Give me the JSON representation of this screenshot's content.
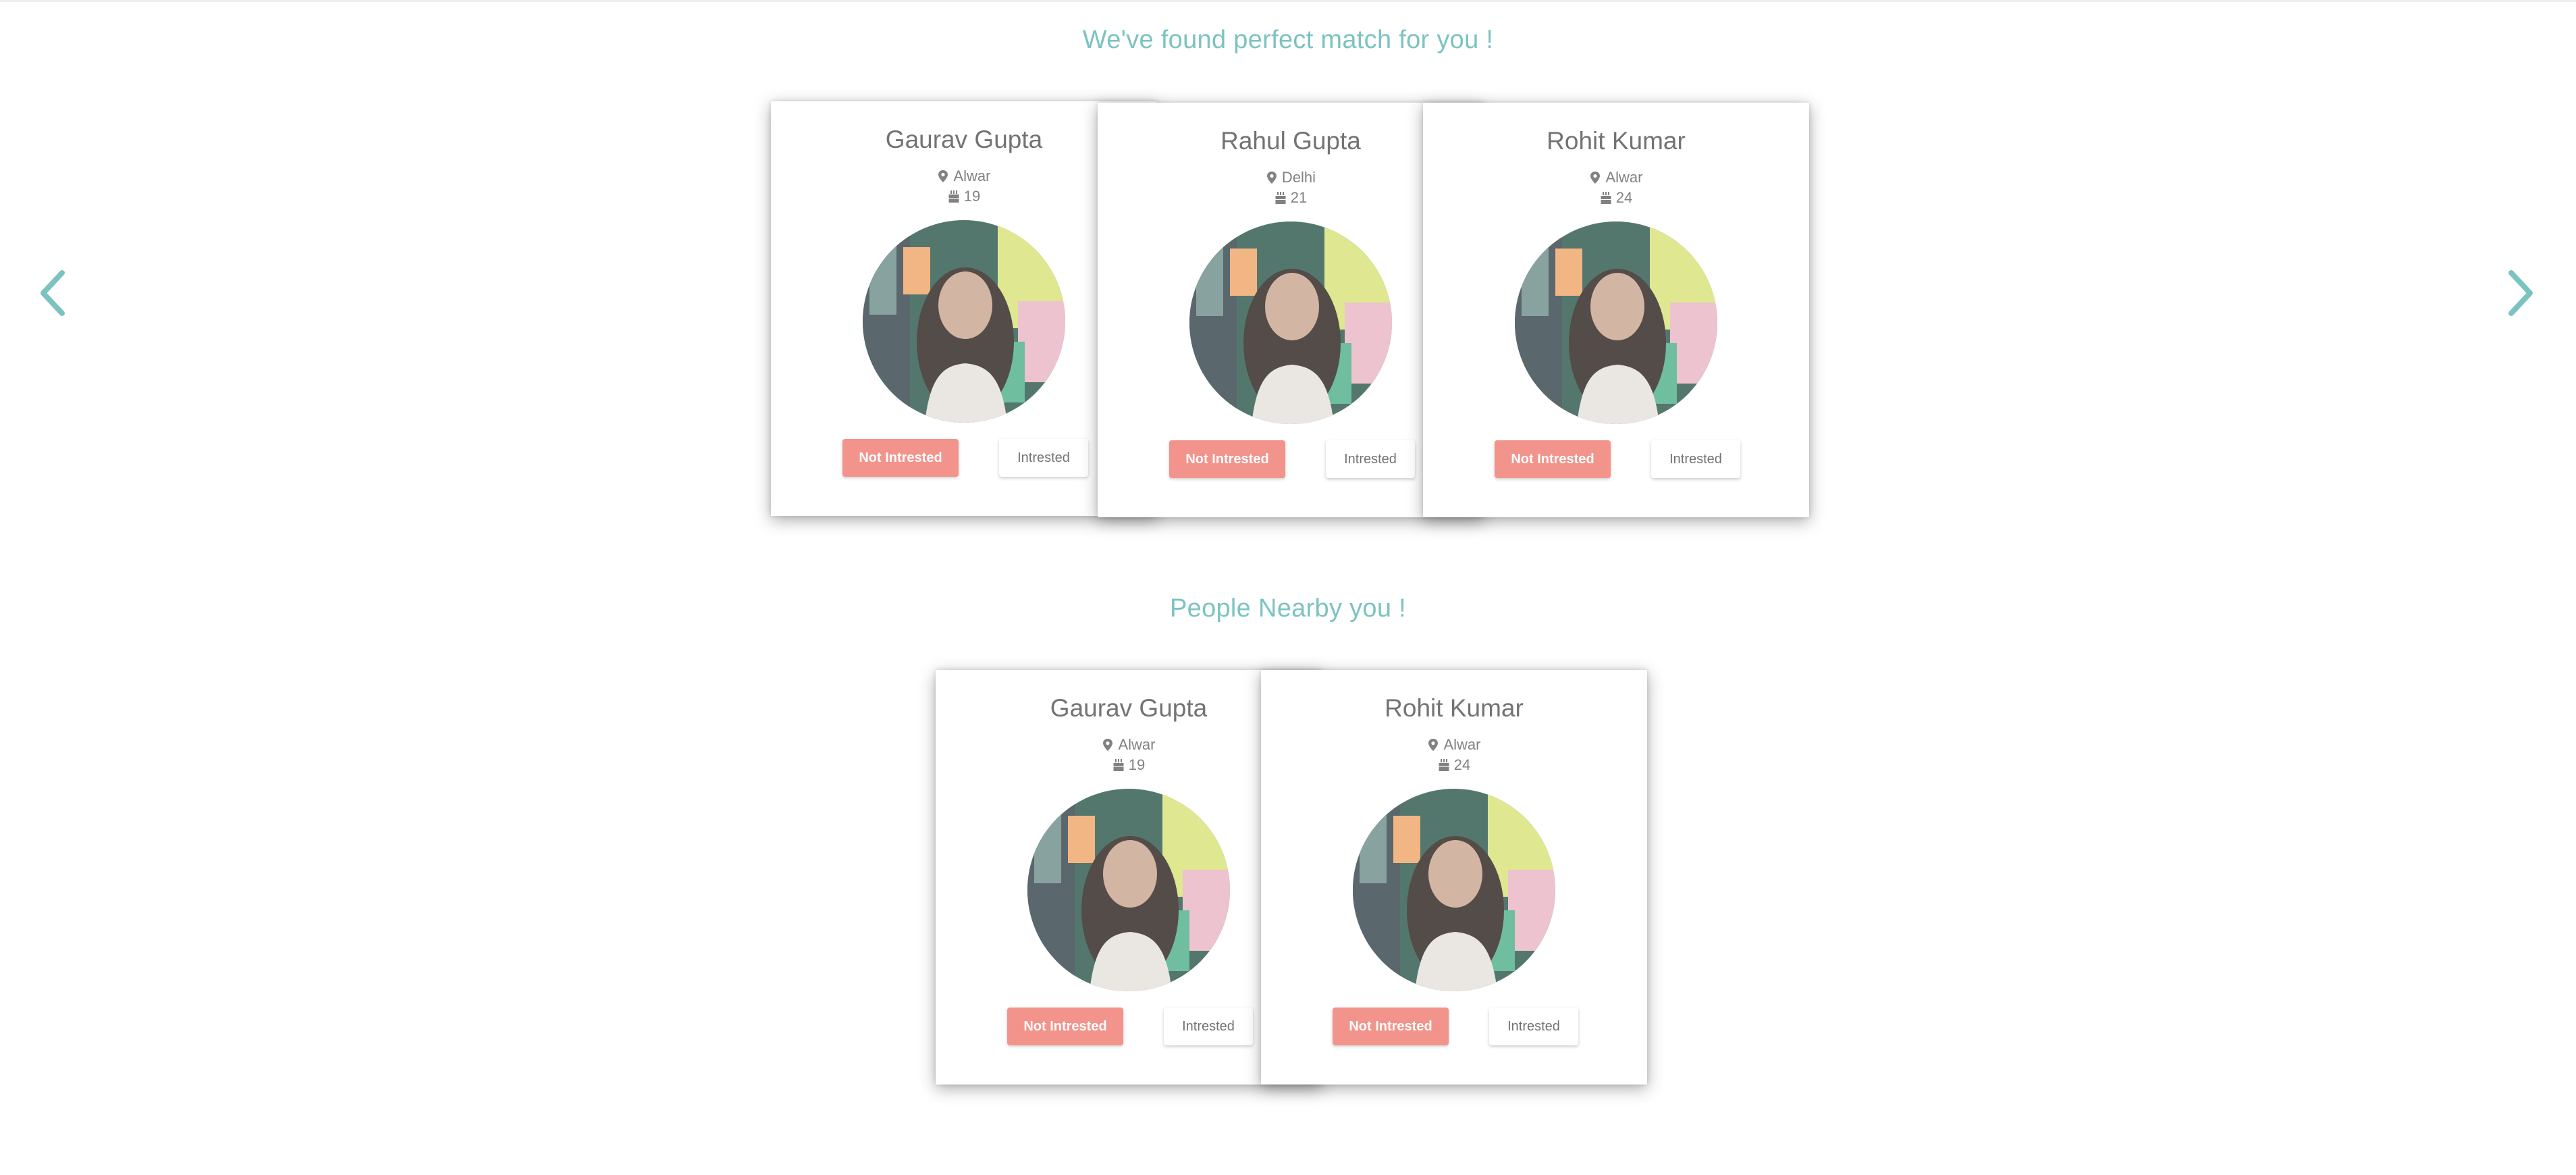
{
  "sections": {
    "matches_title": "We've found perfect match for you !",
    "nearby_title": "People Nearby you !"
  },
  "carousel": {
    "prev_icon": "chevron-left-icon",
    "next_icon": "chevron-right-icon"
  },
  "buttons": {
    "not_interested": "Not Intrested",
    "interested": "Intrested"
  },
  "matches": [
    {
      "name": "Gaurav Gupta",
      "location": "Alwar",
      "age": "19"
    },
    {
      "name": "Rahul Gupta",
      "location": "Delhi",
      "age": "21"
    },
    {
      "name": "Rohit Kumar",
      "location": "Alwar",
      "age": "24"
    }
  ],
  "nearby": [
    {
      "name": "Gaurav Gupta",
      "location": "Alwar",
      "age": "19"
    },
    {
      "name": "Rohit Kumar",
      "location": "Alwar",
      "age": "24"
    }
  ],
  "icons": {
    "location": "map-marker-icon",
    "age": "birthday-cake-icon"
  },
  "colors": {
    "accent": "#5fb6b4",
    "not_interested_bg": "#f07c74",
    "text": "#555555"
  }
}
